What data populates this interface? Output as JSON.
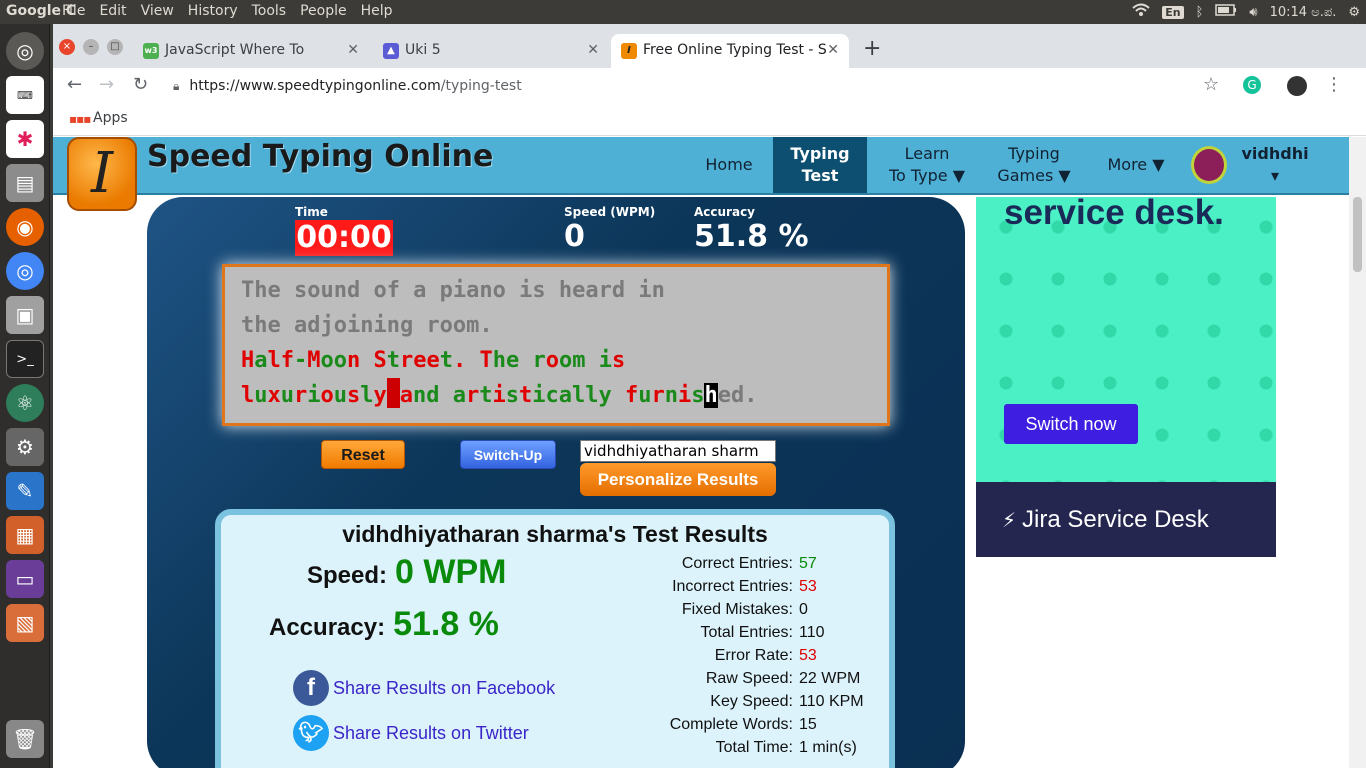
{
  "os": {
    "app_name": "Google C",
    "menus": [
      "File",
      "Edit",
      "View",
      "History",
      "Tools",
      "People",
      "Help"
    ],
    "keyboard_layout": "En",
    "clock": "10:14 ಅ.ಪ."
  },
  "browser": {
    "tabs": [
      {
        "title": "JavaScript Where To",
        "favicon": "w3"
      },
      {
        "title": "Uki 5",
        "favicon": "▲"
      },
      {
        "title": "Free Online Typing Test - S",
        "favicon": "I"
      }
    ],
    "url_host": "https://www.speedtypingonline.com",
    "url_path": "/typing-test",
    "bookmarks_apps": "Apps"
  },
  "site": {
    "name": "Speed Typing Online",
    "logo_letter": "I",
    "nav": [
      {
        "label": "Home"
      },
      {
        "label": "Typing\nTest"
      },
      {
        "label": "Learn\nTo Type ▼"
      },
      {
        "label": "Typing\nGames ▼"
      },
      {
        "label": "More ▼"
      }
    ],
    "user": "vidhdhi ▾"
  },
  "test": {
    "time_label": "Time",
    "time": "00:00",
    "speed_label": "Speed (WPM)",
    "speed": "0",
    "accuracy_label": "Accuracy",
    "accuracy": "51.8 %",
    "text_line1": "The sound of a piano is heard in",
    "text_line2": "the adjoining room.",
    "reset_label": "Reset",
    "switch_label": "Switch-Up",
    "name_value": "vidhdhiyatharan sharm",
    "personalize_label": "Personalize Results"
  },
  "results": {
    "title": "vidhdhiyatharan sharma's Test Results",
    "speed_label": "Speed:",
    "speed_value": "0 WPM",
    "accuracy_label": "Accuracy:",
    "accuracy_value": "51.8 %",
    "share_facebook": "Share Results on Facebook",
    "share_twitter": "Share Results on Twitter",
    "stats": [
      {
        "label": "Correct Entries:",
        "value": "57",
        "color": "green"
      },
      {
        "label": "Incorrect Entries:",
        "value": "53",
        "color": "red"
      },
      {
        "label": "Fixed Mistakes:",
        "value": "0",
        "color": ""
      },
      {
        "label": "Total Entries:",
        "value": "110",
        "color": ""
      },
      {
        "label": "Error Rate:",
        "value": "53",
        "color": "red"
      },
      {
        "label": "Raw Speed:",
        "value": "22 WPM",
        "color": ""
      },
      {
        "label": "Key Speed:",
        "value": "110 KPM",
        "color": ""
      },
      {
        "label": "Complete Words:",
        "value": "15",
        "color": ""
      },
      {
        "label": "Total Time:",
        "value": "1 min(s)",
        "color": ""
      }
    ]
  },
  "ad": {
    "headline": "service desk.",
    "cta": "Switch now",
    "brand": "Jira Service Desk"
  },
  "colors": {
    "nav_bg": "#4fb0d6",
    "nav_active": "#0d4f70",
    "correct": "#1a8a1a",
    "incorrect": "#e00000",
    "timer_bg": "#ff1a1a"
  }
}
